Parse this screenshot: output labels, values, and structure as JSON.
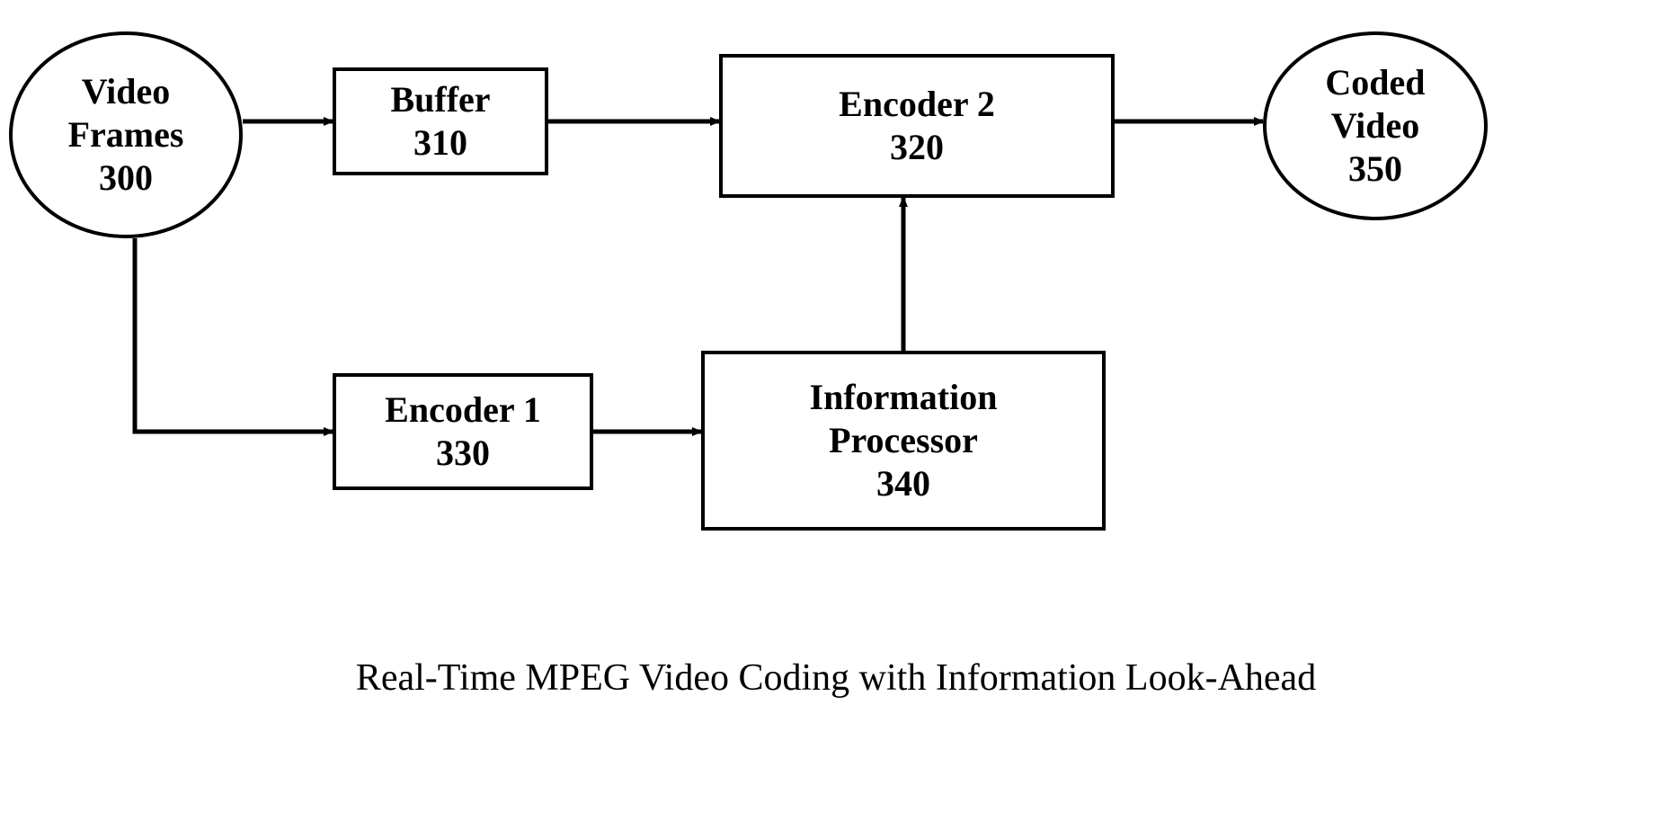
{
  "nodes": {
    "video_frames": {
      "l1": "Video",
      "l2": "Frames",
      "num": "300"
    },
    "buffer": {
      "l1": "Buffer",
      "num": "310"
    },
    "encoder2": {
      "l1": "Encoder 2",
      "num": "320"
    },
    "encoder1": {
      "l1": "Encoder 1",
      "num": "330"
    },
    "info_proc": {
      "l1": "Information",
      "l2": "Processor",
      "num": "340"
    },
    "coded_video": {
      "l1": "Coded",
      "l2": "Video",
      "num": "350"
    }
  },
  "caption": "Real-Time MPEG Video Coding with Information Look-Ahead",
  "chart_data": {
    "type": "diagram",
    "title": "Real-Time MPEG Video Coding with Information Look-Ahead",
    "nodes": [
      {
        "id": "300",
        "label": "Video Frames",
        "shape": "ellipse"
      },
      {
        "id": "310",
        "label": "Buffer",
        "shape": "rect"
      },
      {
        "id": "320",
        "label": "Encoder 2",
        "shape": "rect"
      },
      {
        "id": "330",
        "label": "Encoder 1",
        "shape": "rect"
      },
      {
        "id": "340",
        "label": "Information Processor",
        "shape": "rect"
      },
      {
        "id": "350",
        "label": "Coded Video",
        "shape": "ellipse"
      }
    ],
    "edges": [
      {
        "from": "300",
        "to": "310"
      },
      {
        "from": "310",
        "to": "320"
      },
      {
        "from": "300",
        "to": "330"
      },
      {
        "from": "330",
        "to": "340"
      },
      {
        "from": "340",
        "to": "320"
      },
      {
        "from": "320",
        "to": "350"
      }
    ]
  }
}
